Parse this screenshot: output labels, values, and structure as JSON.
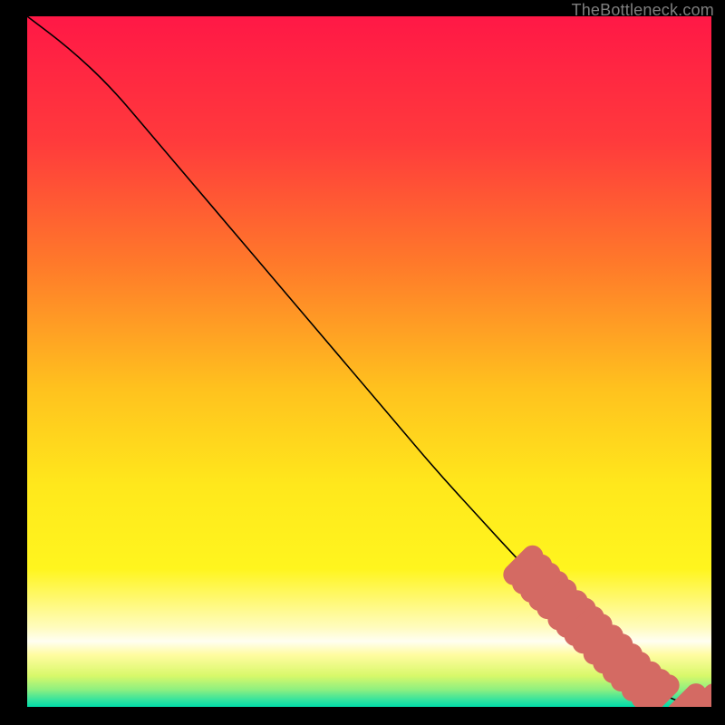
{
  "attribution": "TheBottleneck.com",
  "gradient": {
    "stops": [
      {
        "offset": 0.0,
        "color": "#ff1846"
      },
      {
        "offset": 0.18,
        "color": "#ff3a3c"
      },
      {
        "offset": 0.36,
        "color": "#ff7a2a"
      },
      {
        "offset": 0.54,
        "color": "#ffc21e"
      },
      {
        "offset": 0.68,
        "color": "#ffe81c"
      },
      {
        "offset": 0.8,
        "color": "#fff51e"
      },
      {
        "offset": 0.885,
        "color": "#fffcbe"
      },
      {
        "offset": 0.905,
        "color": "#fffef2"
      },
      {
        "offset": 0.925,
        "color": "#fffca0"
      },
      {
        "offset": 0.955,
        "color": "#d8f86a"
      },
      {
        "offset": 0.975,
        "color": "#8ef080"
      },
      {
        "offset": 0.99,
        "color": "#34e39e"
      },
      {
        "offset": 1.0,
        "color": "#00dca8"
      }
    ]
  },
  "chart_data": {
    "type": "line",
    "title": "",
    "xlabel": "",
    "ylabel": "",
    "xlim": [
      0,
      100
    ],
    "ylim": [
      0,
      100
    ],
    "series": [
      {
        "name": "curve",
        "x": [
          0,
          6,
          12,
          18,
          24,
          30,
          36,
          42,
          48,
          54,
          60,
          66,
          72,
          78,
          84,
          88,
          91,
          93.5,
          95.5,
          97,
          98,
          99,
          100
        ],
        "y": [
          100,
          95.5,
          90,
          83,
          76,
          69,
          62,
          55,
          48,
          41,
          34,
          27.5,
          21,
          15,
          9,
          5.2,
          2.8,
          1.5,
          0.7,
          0.5,
          0.5,
          0.5,
          0.5
        ]
      }
    ],
    "markers": {
      "name": "highlight-points",
      "color": "#d46a63",
      "radius": 1.2,
      "points": [
        {
          "x": 72.5,
          "y": 20.5
        },
        {
          "x": 73.8,
          "y": 19.2
        },
        {
          "x": 75.0,
          "y": 18.0
        },
        {
          "x": 76.2,
          "y": 16.8
        },
        {
          "x": 77.4,
          "y": 15.6
        },
        {
          "x": 79.0,
          "y": 14.0
        },
        {
          "x": 80.2,
          "y": 12.9
        },
        {
          "x": 81.4,
          "y": 11.7
        },
        {
          "x": 82.6,
          "y": 10.6
        },
        {
          "x": 84.2,
          "y": 9.0
        },
        {
          "x": 85.6,
          "y": 7.7
        },
        {
          "x": 87.0,
          "y": 6.3
        },
        {
          "x": 88.2,
          "y": 5.1
        },
        {
          "x": 89.8,
          "y": 3.7
        },
        {
          "x": 91.2,
          "y": 2.6
        },
        {
          "x": 92.4,
          "y": 1.8
        },
        {
          "x": 96.4,
          "y": 0.5
        },
        {
          "x": 99.0,
          "y": 0.5
        },
        {
          "x": 100.0,
          "y": 0.5
        }
      ]
    }
  }
}
